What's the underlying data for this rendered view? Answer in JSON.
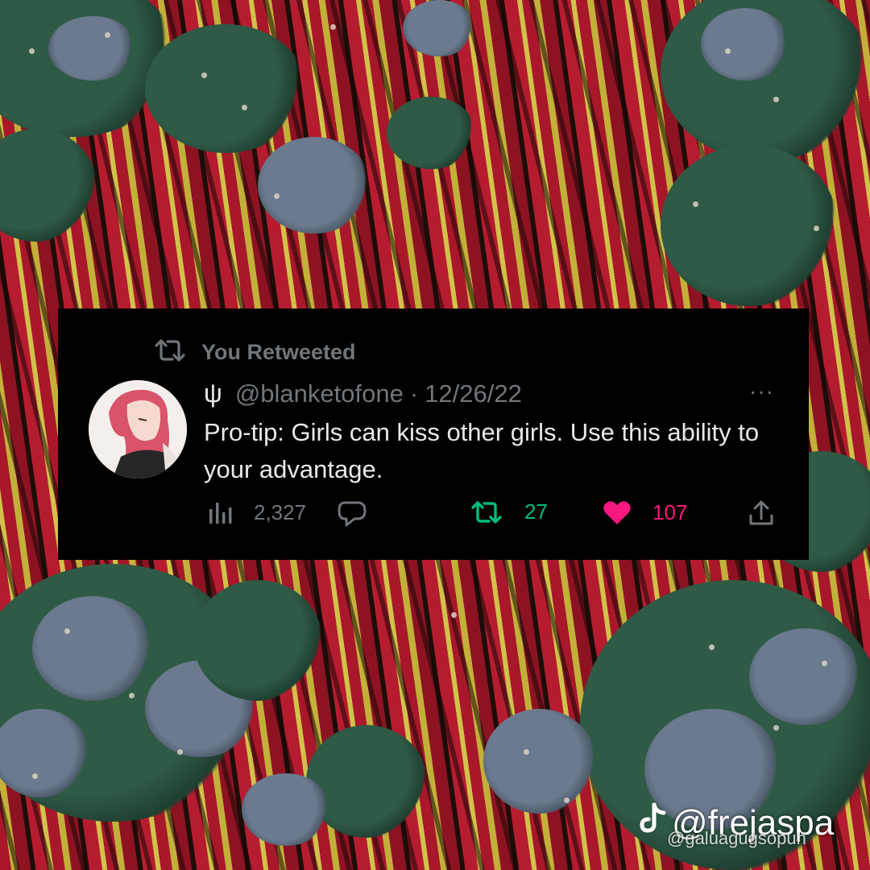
{
  "retweet_banner": {
    "label": "You Retweeted"
  },
  "tweet": {
    "author_symbol": "ψ",
    "handle": "@blanketofone",
    "separator": "·",
    "date": "12/26/22",
    "more": "···",
    "text": "Pro-tip: Girls can kiss other girls. Use this ability to your advantage."
  },
  "actions": {
    "views": "2,327",
    "retweets": "27",
    "likes": "107"
  },
  "colors": {
    "retweet_green": "#00ba7c",
    "like_pink": "#f91880",
    "muted": "#71767b"
  },
  "icons": [
    "retweet-icon",
    "views-icon",
    "reply-icon",
    "like-icon",
    "share-icon",
    "more-icon",
    "tiktok-icon"
  ],
  "watermark": {
    "handle": "@frejaspa",
    "sub": "@galuagugsopun"
  }
}
